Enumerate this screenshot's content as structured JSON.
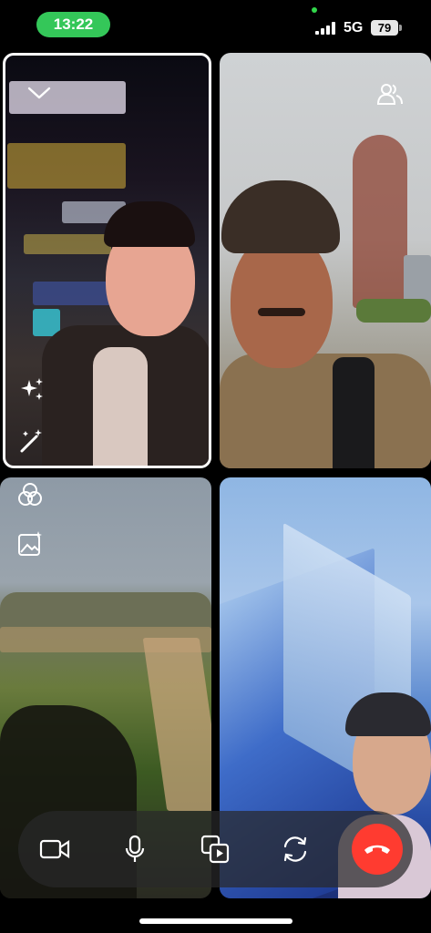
{
  "status_bar": {
    "time": "13:22",
    "network": "5G",
    "battery": "79"
  },
  "tiles": [
    {
      "name": "participant-1",
      "selected": true
    },
    {
      "name": "participant-2",
      "selected": false
    },
    {
      "name": "participant-3",
      "selected": false
    },
    {
      "name": "participant-4",
      "selected": false
    }
  ],
  "tile_icons": {
    "collapse": "chevron-down-icon",
    "participants": "people-icon",
    "effects": "sparkles-icon",
    "magic": "magic-wand-icon",
    "filters": "overlapping-circles-icon",
    "background": "image-sparkle-icon"
  },
  "controls": {
    "video": "video-camera-icon",
    "mic": "microphone-icon",
    "share": "share-media-icon",
    "flip": "flip-camera-icon",
    "end": "end-call-icon"
  },
  "colors": {
    "time_pill": "#34c759",
    "end_call": "#ff3b30"
  }
}
